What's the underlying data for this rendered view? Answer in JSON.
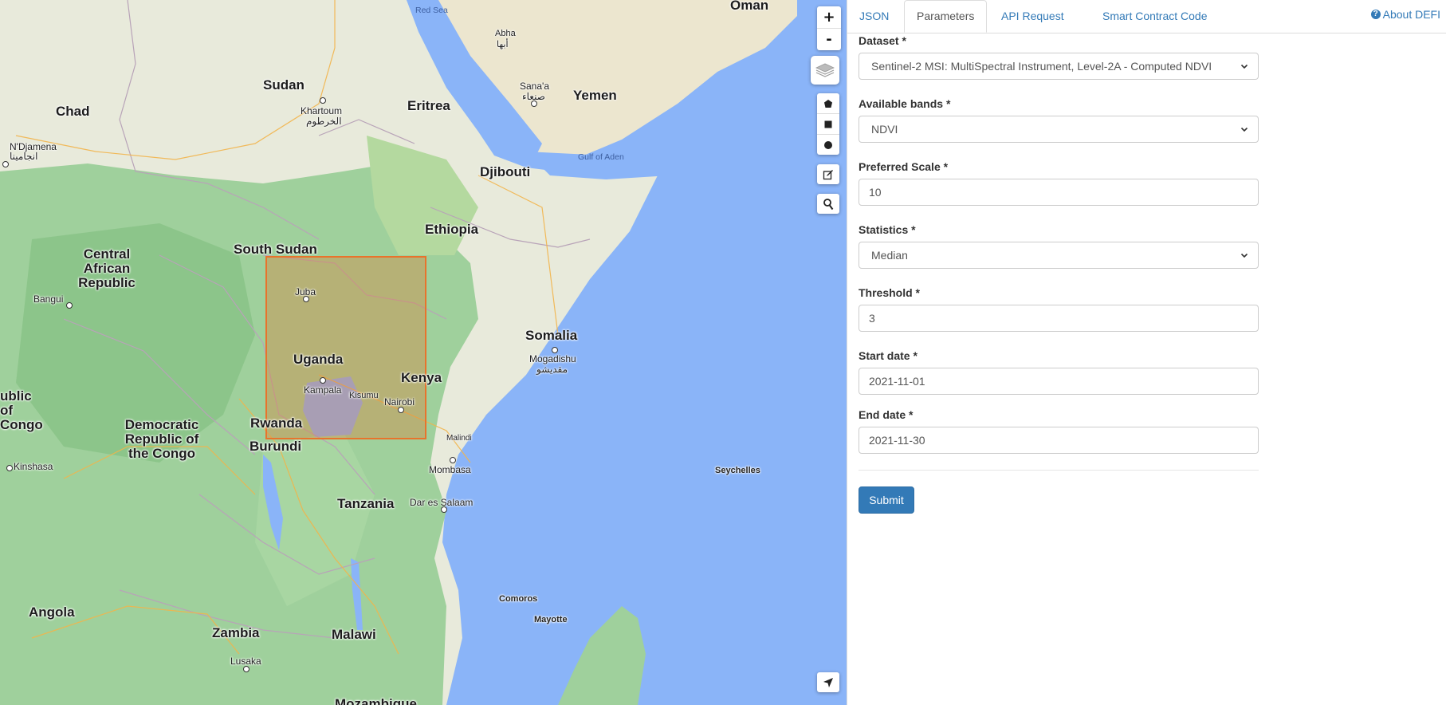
{
  "map": {
    "zoom_in": "+",
    "zoom_out": "-",
    "countries": {
      "oman": "Oman",
      "sudan": "Sudan",
      "chad": "Chad",
      "eritrea": "Eritrea",
      "yemen": "Yemen",
      "djibouti": "Djibouti",
      "ethiopia": "Ethiopia",
      "south_sudan": "South Sudan",
      "central_african_republic": "Central African Republic",
      "uganda": "Uganda",
      "kenya": "Kenya",
      "somalia": "Somalia",
      "rwanda": "Rwanda",
      "burundi": "Burundi",
      "dr_congo": "Democratic Republic of the Congo",
      "republic_of_congo": "ublic of Congo",
      "tanzania": "Tanzania",
      "angola": "Angola",
      "zambia": "Zambia",
      "malawi": "Malawi",
      "mozambique": "Mozambique"
    },
    "cities": {
      "red_sea": "Red Sea",
      "abha": "Abha",
      "abha_ar": "أبها",
      "khartoum": "Khartoum",
      "khartoum_ar": "الخرطوم",
      "sanaa": "Sana'a",
      "sanaa_ar": "صنعاء",
      "ndjamena": "N'Djamena",
      "ndjamena_ar": "انجامينا",
      "gulf_of_aden": "Gulf of Aden",
      "bangui": "Bangui",
      "juba": "Juba",
      "kampala": "Kampala",
      "kisumu": "Kisumu",
      "nairobi": "Nairobi",
      "mogadishu": "Mogadishu",
      "mogadishu_ar": "مقديشو",
      "kinshasa": "Kinshasa",
      "malindi": "Malindi",
      "mombasa": "Mombasa",
      "seychelles": "Seychelles",
      "dar_es_salaam": "Dar es Salaam",
      "comoros": "Comoros",
      "mayotte": "Mayotte",
      "lusaka": "Lusaka"
    }
  },
  "tabs": [
    "JSON",
    "Parameters",
    "API Request",
    "Smart Contract Code"
  ],
  "active_tab": "Parameters",
  "about": "About DEFI",
  "form": {
    "dataset": {
      "label": "Dataset *",
      "value": "Sentinel-2 MSI: MultiSpectral Instrument, Level-2A - Computed NDVI"
    },
    "bands": {
      "label": "Available bands *",
      "value": "NDVI"
    },
    "scale": {
      "label": "Preferred Scale *",
      "value": "10"
    },
    "statistics": {
      "label": "Statistics *",
      "value": "Median"
    },
    "threshold": {
      "label": "Threshold *",
      "value": "3"
    },
    "start_date": {
      "label": "Start date *",
      "value": "2021-11-01"
    },
    "end_date": {
      "label": "End date *",
      "value": "2021-11-30"
    },
    "submit": "Submit"
  },
  "colors": {
    "accent": "#337ab7",
    "land": "#e8eadb",
    "green": "#9fd09c",
    "water": "#8ab4f8",
    "selection": "#e8732c"
  }
}
